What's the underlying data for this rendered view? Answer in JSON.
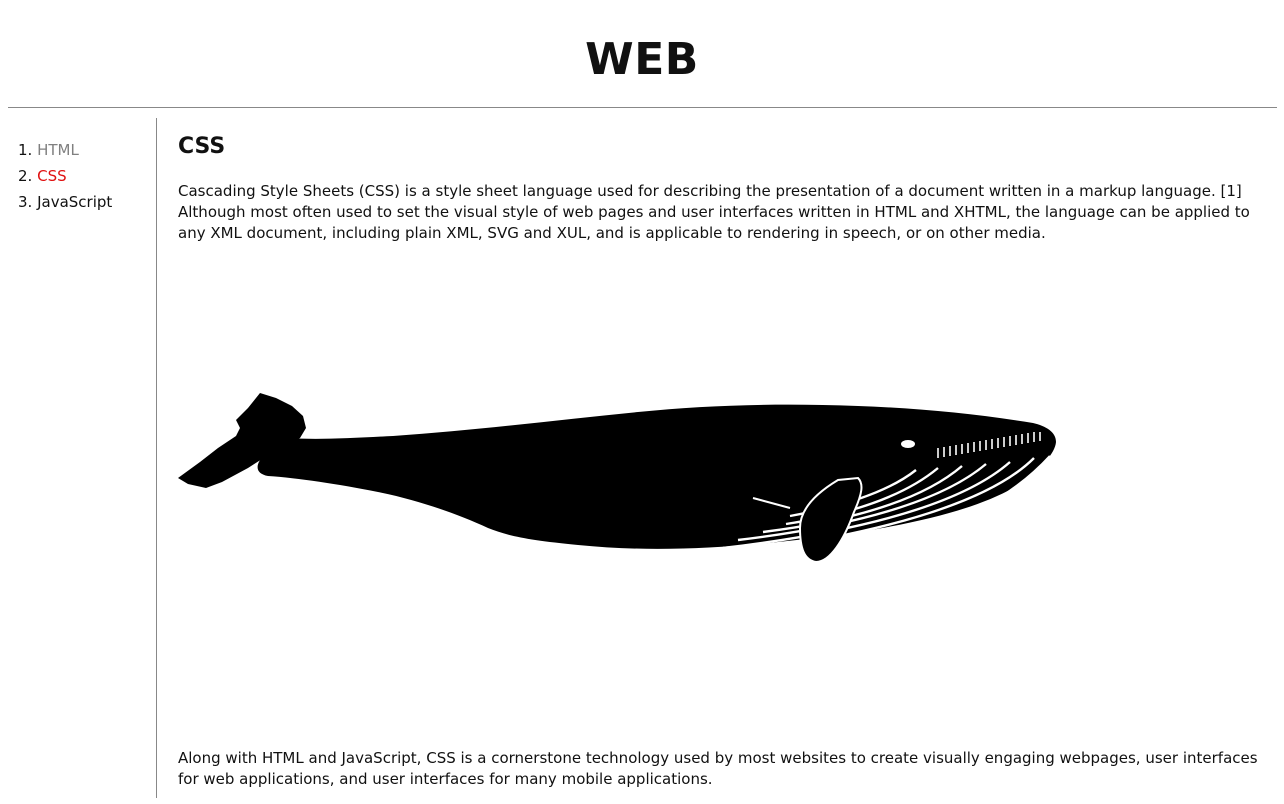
{
  "header": {
    "title": "WEB"
  },
  "nav": {
    "items": [
      {
        "number": "1.",
        "label": "HTML",
        "state": "visited"
      },
      {
        "number": "2.",
        "label": "CSS",
        "state": "active"
      },
      {
        "number": "3.",
        "label": "JavaScript",
        "state": "normal"
      }
    ]
  },
  "article": {
    "title": "CSS",
    "paragraph_1": "Cascading Style Sheets (CSS) is a style sheet language used for describing the presentation of a document written in a markup language. [1] Although most often used to set the visual style of web pages and user interfaces written in HTML and XHTML, the language can be applied to any XML document, including plain XML, SVG and XUL, and is applicable to rendering in speech, or on other media.",
    "image_icon": "whale-silhouette-icon",
    "paragraph_2": "Along with HTML and JavaScript, CSS is a cornerstone technology used by most websites to create visually engaging webpages, user interfaces for web applications, and user interfaces for many mobile applications."
  },
  "colors": {
    "active_link": "#e01010",
    "visited_link": "#808080",
    "rule": "#888888"
  }
}
